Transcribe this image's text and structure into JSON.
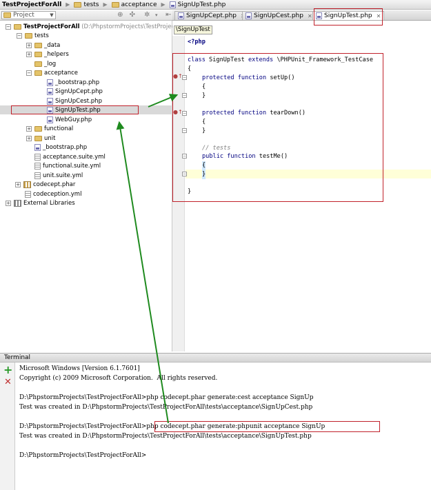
{
  "breadcrumb": [
    "TestProjectForAll",
    "tests",
    "acceptance",
    "SignUpTest.php"
  ],
  "project_toolbar": {
    "view_label": "Project"
  },
  "editor_tabs": [
    {
      "label": "SignUpCept.php",
      "active": false
    },
    {
      "label": "SignUpCest.php",
      "active": false
    },
    {
      "label": "SignUpTest.php",
      "active": true
    }
  ],
  "tree": {
    "root": "TestProjectForAll",
    "root_path": "(D:\\PhpstormProjects\\TestProjectFor",
    "tests": "tests",
    "data": "_data",
    "helpers": "_helpers",
    "log": "_log",
    "acceptance": "acceptance",
    "acc_bootstrap": "_bootstrap.php",
    "signupcept": "SignUpCept.php",
    "signupcest": "SignUpCest.php",
    "signuptest": "SignUpTest.php",
    "webguy": "WebGuy.php",
    "functional": "functional",
    "unit": "unit",
    "bootstrap": "_bootstrap.php",
    "acceptance_suite": "acceptance.suite.yml",
    "functional_suite": "functional.suite.yml",
    "unit_suite": "unit.suite.yml",
    "codecept_phar": "codecept.phar",
    "codeception_yml": "codeception.yml",
    "external_libraries": "External Libraries"
  },
  "editor": {
    "structure_hint": "\\SignUpTest",
    "php_open": "<?php",
    "class_kw": "class",
    "class_name": " SignUpTest ",
    "extends_kw": "extends",
    "parent_class": " \\PHPUnit_Framework_TestCase",
    "brace_open": "{",
    "brace_close": "}",
    "protected_function": "protected function",
    "public_function": "public function",
    "setup_sig": " setUp()",
    "teardown_sig": " tearDown()",
    "test_sig": " testMe()",
    "comment": "// tests"
  },
  "terminal": {
    "title": "Terminal",
    "lines": [
      "Microsoft Windows [Version 6.1.7601]",
      "Copyright (c) 2009 Microsoft Corporation.  All rights reserved.",
      "",
      "D:\\PhpstormProjects\\TestProjectForAll>php codecept.phar generate:cest acceptance SignUp",
      "Test was created in D:\\PhpstormProjects\\TestProjectForAll\\tests\\acceptance\\SignUpCest.php",
      "",
      "D:\\PhpstormProjects\\TestProjectForAll>php codecept.phar generate:phpunit acceptance SignUp",
      "Test was created in D:\\PhpstormProjects\\TestProjectForAll\\tests\\acceptance\\SignUpTest.php",
      "",
      "D:\\PhpstormProjects\\TestProjectForAll>"
    ]
  },
  "colors": {
    "annotation_red": "#c0202a",
    "annotation_green": "#1e8a1e",
    "keyword": "#000080"
  }
}
